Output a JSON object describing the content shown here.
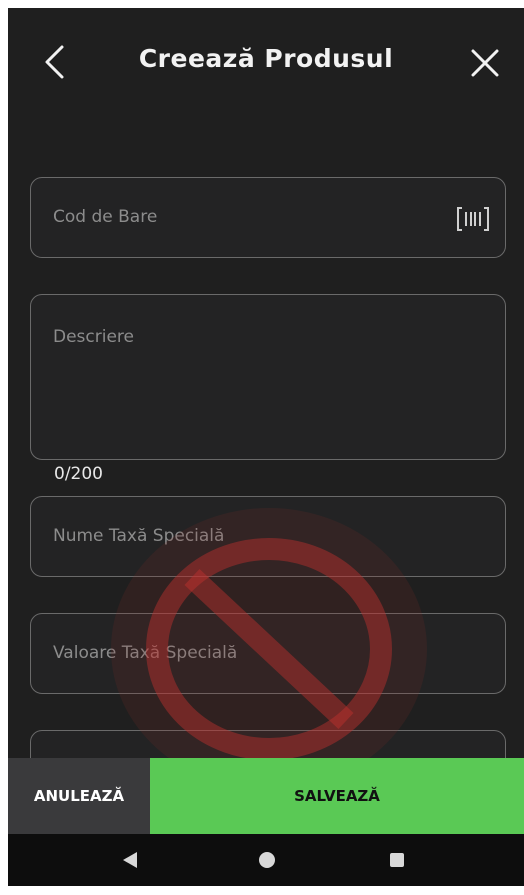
{
  "header": {
    "title": "Creează Produsul",
    "back_icon": "chevron-left-icon",
    "close_icon": "close-icon"
  },
  "form": {
    "barcode": {
      "placeholder": "Cod de Bare",
      "icon": "barcode-scan-icon"
    },
    "description": {
      "placeholder": "Descriere",
      "counter": "0/200"
    },
    "special_tax_name": {
      "placeholder": "Nume Taxă Specială"
    },
    "special_tax_value": {
      "placeholder": "Valoare Taxă Specială"
    }
  },
  "actions": {
    "cancel_label": "ANULEAZĂ",
    "save_label": "SALVEAZĂ"
  },
  "colors": {
    "background": "#1f1f1f",
    "field_border": "#6a6a6a",
    "save_button": "#5ac955",
    "cancel_button": "#3a3a3c",
    "watermark": "#c0302e"
  }
}
